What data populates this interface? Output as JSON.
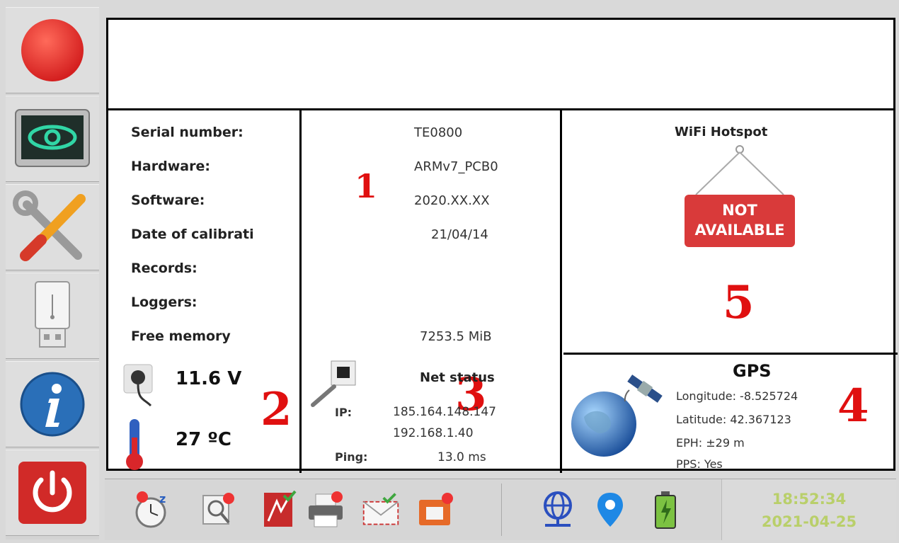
{
  "device": {
    "labels": [
      "Serial number:",
      "Hardware:",
      "Software:",
      "Date of calibrati",
      "Records:",
      "Loggers:",
      "Free memory"
    ],
    "values": [
      "TE0800",
      "ARMv7_PCB0",
      "2020.XX.XX",
      "21/04/14",
      "",
      "",
      "7253.5 MiB"
    ]
  },
  "power": {
    "voltage": "11.6 V",
    "temperature": "27 ºC"
  },
  "net": {
    "title": "Net status",
    "ip_label": "IP:",
    "ip_public": "185.164.148.147",
    "ip_local": "192.168.1.40",
    "ping_label": "Ping:",
    "ping_value": "13.0 ms"
  },
  "gps": {
    "title": "GPS",
    "longitude": "Longitude: -8.525724",
    "latitude": "Latitude: 42.367123",
    "eph": "EPH: ±29 m",
    "pps": "PPS: Yes"
  },
  "wifi": {
    "title": "WiFi Hotspot",
    "sign_line1": "NOT",
    "sign_line2": "AVAILABLE"
  },
  "annotations": [
    "1",
    "2",
    "3",
    "4",
    "5"
  ],
  "clock": {
    "time": "18:52:34",
    "date": "2021-04-25"
  },
  "colors": {
    "record_red": "#e53030",
    "annotation_red": "#e01010",
    "clock_text": "#b9cf6a"
  }
}
